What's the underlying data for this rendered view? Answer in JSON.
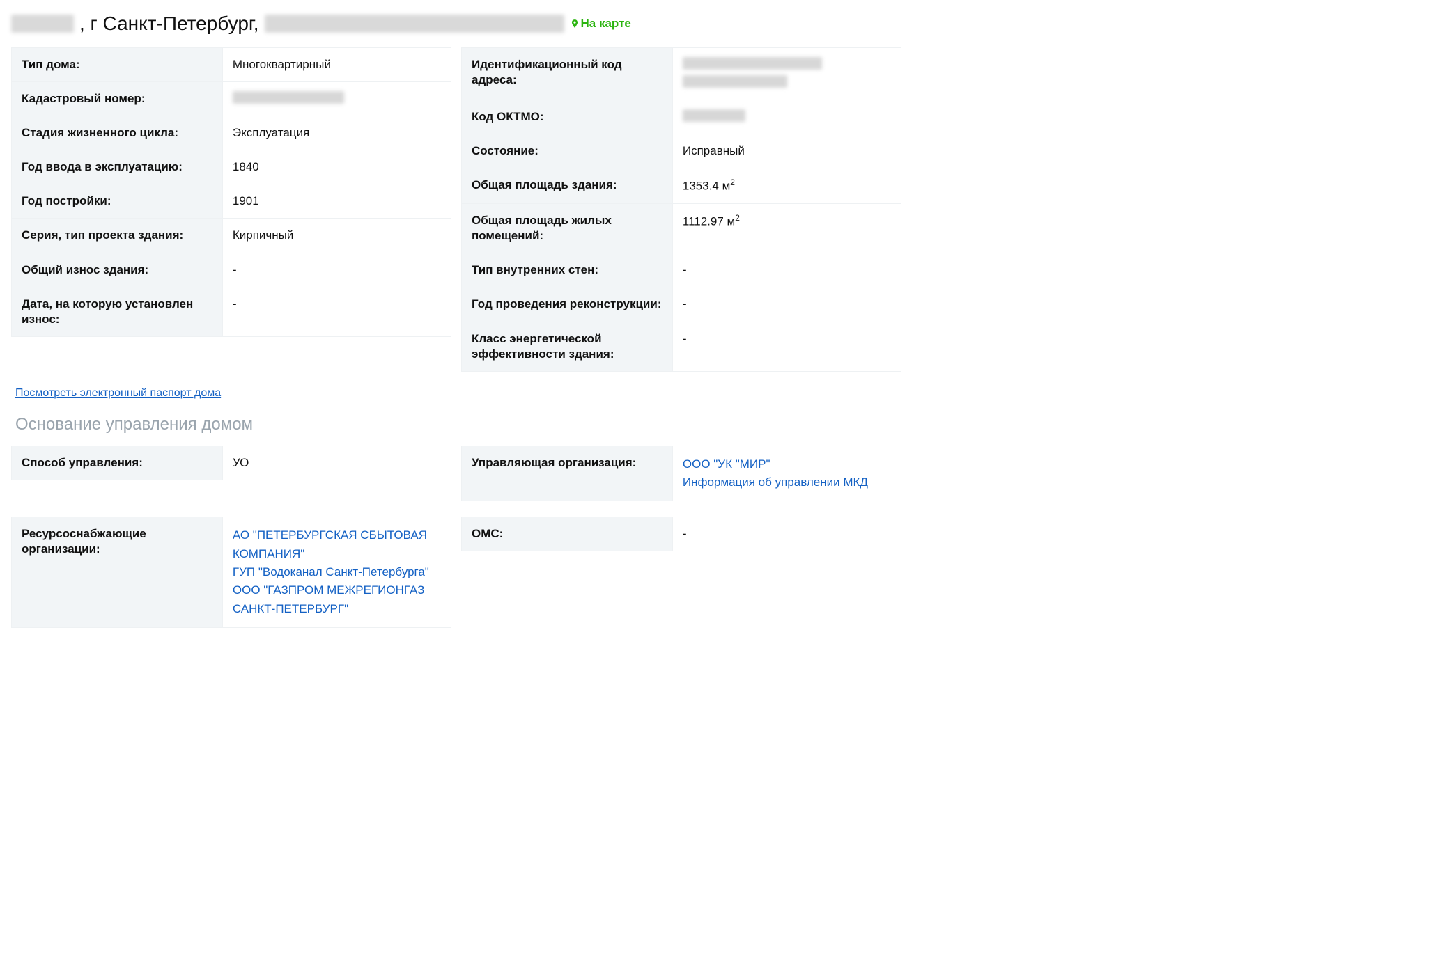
{
  "header": {
    "city_part": ", г Санкт-Петербург,",
    "map_link": "На карте"
  },
  "left_block": [
    {
      "label": "Тип дома:",
      "value": "Многоквартирный",
      "blur": false
    },
    {
      "label": "Кадастровый номер:",
      "value": "",
      "blur": true,
      "blurClass": "bv-cad"
    },
    {
      "label": "Стадия жизненного цикла:",
      "value": "Эксплуатация",
      "blur": false
    },
    {
      "label": "Год ввода в эксплуатацию:",
      "value": "1840",
      "blur": false
    },
    {
      "label": "Год постройки:",
      "value": "1901",
      "blur": false
    },
    {
      "label": "Серия, тип проекта здания:",
      "value": "Кирпичный",
      "blur": false
    },
    {
      "label": "Общий износ здания:",
      "value": "-",
      "blur": false
    },
    {
      "label": "Дата, на которую установлен износ:",
      "value": "-",
      "blur": false
    }
  ],
  "right_block": [
    {
      "label": "Идентификационный код адреса:",
      "value": "",
      "blur": true,
      "double": true
    },
    {
      "label": "Код ОКТМО:",
      "value": "",
      "blur": true,
      "blurClass": "bv-c"
    },
    {
      "label": "Состояние:",
      "value": "Исправный",
      "blur": false
    },
    {
      "label": "Общая площадь здания:",
      "value": "1353.4 м",
      "sup": "2",
      "blur": false
    },
    {
      "label": "Общая площадь жилых помещений:",
      "value": "1112.97 м",
      "sup": "2",
      "blur": false
    },
    {
      "label": "Тип внутренних стен:",
      "value": "-",
      "blur": false
    },
    {
      "label": "Год проведения реконструкции:",
      "value": "-",
      "blur": false
    },
    {
      "label": "Класс энергетической эффективности здания:",
      "value": "-",
      "blur": false
    }
  ],
  "passport_link": "Посмотреть электронный паспорт дома",
  "management_section_title": "Основание управления домом",
  "management_left": {
    "label": "Способ управления:",
    "value": "УО"
  },
  "management_right": {
    "label": "Управляющая организация:",
    "links": [
      "ООО \"УК \"МИР\"",
      "Информация об управлении МКД"
    ]
  },
  "resource_left": {
    "label": "Ресурсоснабжающие организации:",
    "links": [
      "АО \"ПЕТЕРБУРГСКАЯ СБЫТОВАЯ КОМПАНИЯ\"",
      "ГУП \"Водоканал Санкт-Петербурга\"",
      "ООО \"ГАЗПРОМ МЕЖРЕГИОНГАЗ САНКТ-ПЕТЕРБУРГ\""
    ]
  },
  "resource_right": {
    "label": "ОМС:",
    "value": "-"
  }
}
